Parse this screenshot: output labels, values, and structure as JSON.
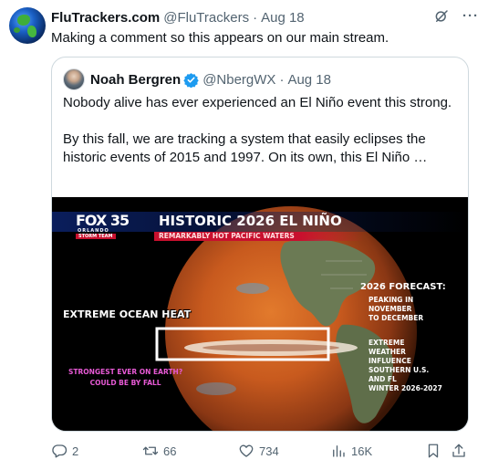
{
  "post": {
    "author_name": "FluTrackers.com",
    "author_handle": "@FluTrackers",
    "separator": "·",
    "date": "Aug 18",
    "more_icon": "more-icon",
    "grok_icon": "grok-icon",
    "text": "Making a comment so this appears on our main stream."
  },
  "quote": {
    "author_name": "Noah Bergren",
    "author_handle": "@NbergWX",
    "separator": "·",
    "date": "Aug 18",
    "verified_color": "#1d9bf0",
    "paragraph1": "Nobody alive has ever experienced an El Niño event this strong.",
    "paragraph2": "By this fall, we are tracking a system that easily eclipses the historic events of 2015 and 1997. On its own, this El Niño …"
  },
  "media": {
    "logo": "FOX 35",
    "logo_sub": "ORLANDO",
    "logo_team": "STORM TEAM",
    "headline": "HISTORIC 2026 EL NIÑO",
    "subhead": "REMARKABLY HOT PACIFIC WATERS",
    "heat_label": "EXTREME OCEAN HEAT",
    "strongest_line1": "STRONGEST EVER ON EARTH?",
    "strongest_line2": "COULD BE BY FALL",
    "forecast_title": "2026 FORECAST:",
    "forecast_peaking": "PEAKING IN\nNOVEMBER\nTO DECEMBER",
    "forecast_influence": "EXTREME\nWEATHER\nINFLUENCE\nSOUTHERN U.S.\nAND FL\nWINTER 2026-2027",
    "accent_red": "#c8102e",
    "accent_navy": "#0a1e5c"
  },
  "actions": {
    "replies": "2",
    "reposts": "66",
    "likes": "734",
    "views": "16K",
    "bookmark_icon": "bookmark-icon",
    "share_icon": "share-icon"
  }
}
